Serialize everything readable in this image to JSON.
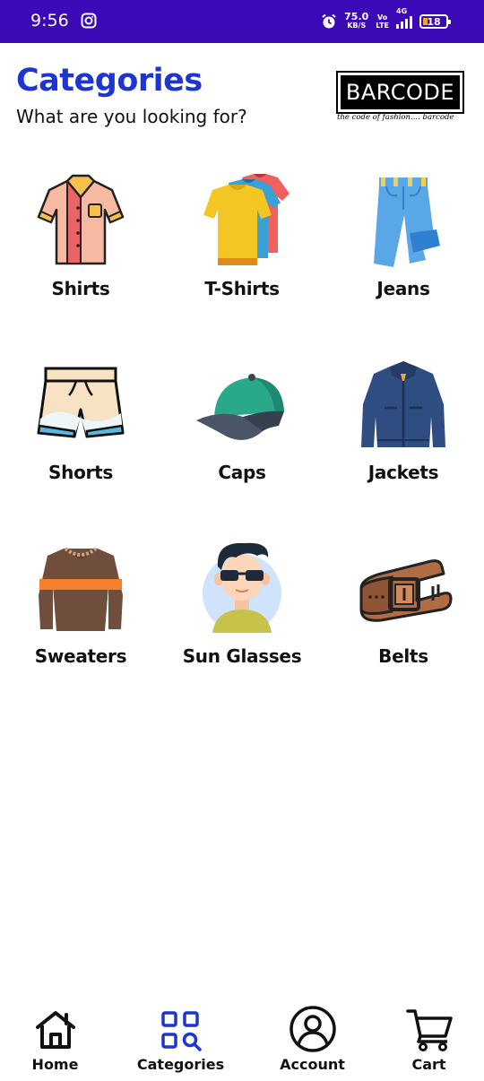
{
  "status_bar": {
    "time": "9:56",
    "speed_value": "75.0",
    "speed_unit": "KB/S",
    "volte_top": "Vo",
    "volte_bottom": "LTE",
    "network": "4G",
    "battery": "18"
  },
  "header": {
    "title": "Categories",
    "subtitle": "What are you looking for?",
    "brand_name": "BARCODE",
    "brand_tagline": "the code of fashion.... barcode"
  },
  "categories": [
    {
      "label": "Shirts",
      "icon": "shirt-icon"
    },
    {
      "label": "T-Shirts",
      "icon": "tshirts-icon"
    },
    {
      "label": "Jeans",
      "icon": "jeans-icon"
    },
    {
      "label": "Shorts",
      "icon": "shorts-icon"
    },
    {
      "label": "Caps",
      "icon": "cap-icon"
    },
    {
      "label": "Jackets",
      "icon": "jacket-icon"
    },
    {
      "label": "Sweaters",
      "icon": "sweater-icon"
    },
    {
      "label": "Sun Glasses",
      "icon": "sunglasses-icon"
    },
    {
      "label": "Belts",
      "icon": "belt-icon"
    }
  ],
  "bottom_nav": [
    {
      "label": "Home",
      "icon": "home-icon",
      "active": false
    },
    {
      "label": "Categories",
      "icon": "categories-icon",
      "active": true
    },
    {
      "label": "Account",
      "icon": "account-icon",
      "active": false
    },
    {
      "label": "Cart",
      "icon": "cart-icon",
      "active": false
    }
  ],
  "colors": {
    "status_bar": "#3b09b5",
    "title": "#1e35d1",
    "active_nav": "#1e35d1"
  }
}
